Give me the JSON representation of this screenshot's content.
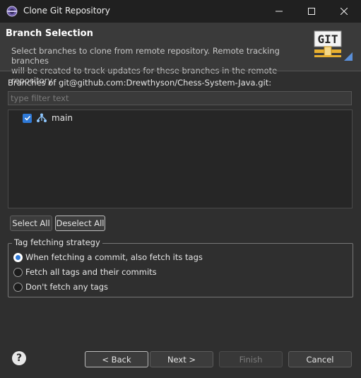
{
  "window": {
    "title": "Clone Git Repository",
    "minimize_icon": "minimize-icon",
    "maximize_icon": "maximize-icon",
    "close_icon": "close-icon"
  },
  "header": {
    "title": "Branch Selection",
    "description": "Select branches to clone from remote repository. Remote tracking branches\nwill be created to track updates for these branches in the remote repository.",
    "logo_text": "GIT"
  },
  "branches": {
    "label": "Branches of git@github.com:Drewthyson/Chess-System-Java.git:",
    "filter_placeholder": "type filter text",
    "items": [
      {
        "label": "main",
        "checked": true,
        "icon": "branch-icon"
      }
    ]
  },
  "selection_buttons": {
    "select_all": "Select All",
    "deselect_all": "Deselect All"
  },
  "tag_fetching": {
    "title": "Tag fetching strategy",
    "options": [
      {
        "label": "When fetching a commit, also fetch its tags",
        "selected": true
      },
      {
        "label": "Fetch all tags and their commits",
        "selected": false
      },
      {
        "label": "Don't fetch any tags",
        "selected": false
      }
    ]
  },
  "footer": {
    "help_icon": "help-icon",
    "back": "< Back",
    "next": "Next >",
    "finish": "Finish",
    "cancel": "Cancel"
  },
  "colors": {
    "accent": "#2f7ad8",
    "background": "#2f2f2f",
    "titlebar": "#202020"
  }
}
